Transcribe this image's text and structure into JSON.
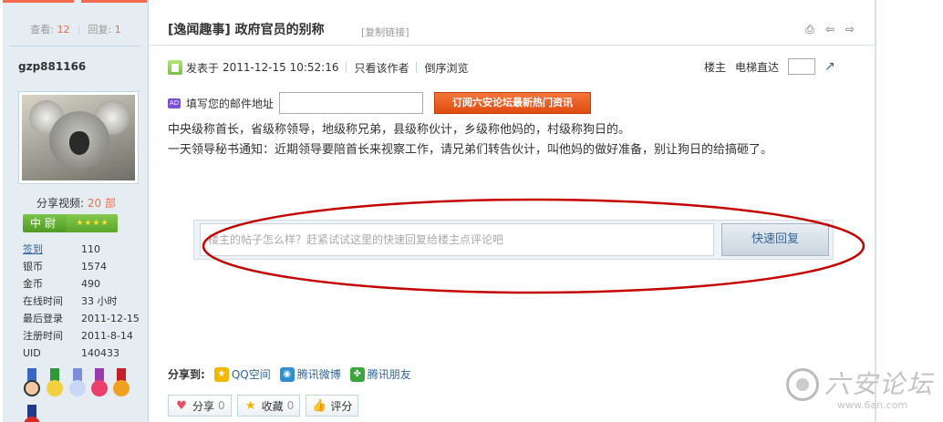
{
  "sidebar": {
    "stats": {
      "views_label": "查看:",
      "views": "12",
      "replies_label": "回复:",
      "replies": "1"
    },
    "username": "gzp881166",
    "share_video": {
      "label": "分享视频:",
      "count": "20 部"
    },
    "rank": {
      "name": "中尉"
    },
    "info": [
      {
        "key": "签到",
        "value": "110",
        "link": true
      },
      {
        "key": "银币",
        "value": "1574",
        "link": false
      },
      {
        "key": "金币",
        "value": "490",
        "link": false
      },
      {
        "key": "在线时间",
        "value": "33 小时",
        "link": false
      },
      {
        "key": "最后登录",
        "value": "2011-12-15",
        "link": false
      },
      {
        "key": "注册时间",
        "value": "2011-8-14",
        "link": false
      },
      {
        "key": "UID",
        "value": "140433",
        "link": false
      }
    ]
  },
  "post": {
    "title": "[逸闻趣事] 政府官员的别称",
    "copy_link": "[复制链接]",
    "meta": {
      "posted_prefix": "发表于",
      "posted_time": "2011-12-15 10:52:16",
      "only_author": "只看该作者",
      "reverse_order": "倒序浏览",
      "floor_owner": "楼主",
      "jump_label": "电梯直达"
    },
    "ad": {
      "icon_text": "AD",
      "label": "填写您的邮件地址",
      "email_value": "",
      "subscribe_label": "订阅六安论坛最新热门资讯"
    },
    "body": [
      "中央级称首长，省级称领导，地级称兄弟，县级称伙计，乡级称他妈的，村级称狗日的。",
      "一天领导秘书通知：近期领导要陪首长来视察工作，请兄弟们转告伙计，叫他妈的做好准备，别让狗日的给搞砸了。"
    ],
    "quick_reply": {
      "placeholder": "楼主的帖子怎么样？赶紧试试这里的快速回复给楼主点评论吧",
      "button_label": "快速回复"
    },
    "share": {
      "label": "分享到:",
      "items": [
        {
          "label": "QQ空间",
          "icon": "qzone-icon",
          "color": "#f5b800"
        },
        {
          "label": "腾讯微博",
          "icon": "tencent-weibo-icon",
          "color": "#2f8fd1"
        },
        {
          "label": "腾讯朋友",
          "icon": "tencent-friends-icon",
          "color": "#3aa63a"
        }
      ]
    },
    "actions": [
      {
        "label": "分享",
        "count": "0",
        "icon": "heart-icon"
      },
      {
        "label": "收藏",
        "count": "0",
        "icon": "star-icon"
      },
      {
        "label": "评分",
        "icon": "thumbs-up-icon"
      }
    ]
  },
  "watermark": {
    "title": "六安论坛",
    "url": "www.6an.com"
  },
  "colors": {
    "accent": "#f26c4f",
    "link": "#336699",
    "ellipse": "#c40000"
  }
}
